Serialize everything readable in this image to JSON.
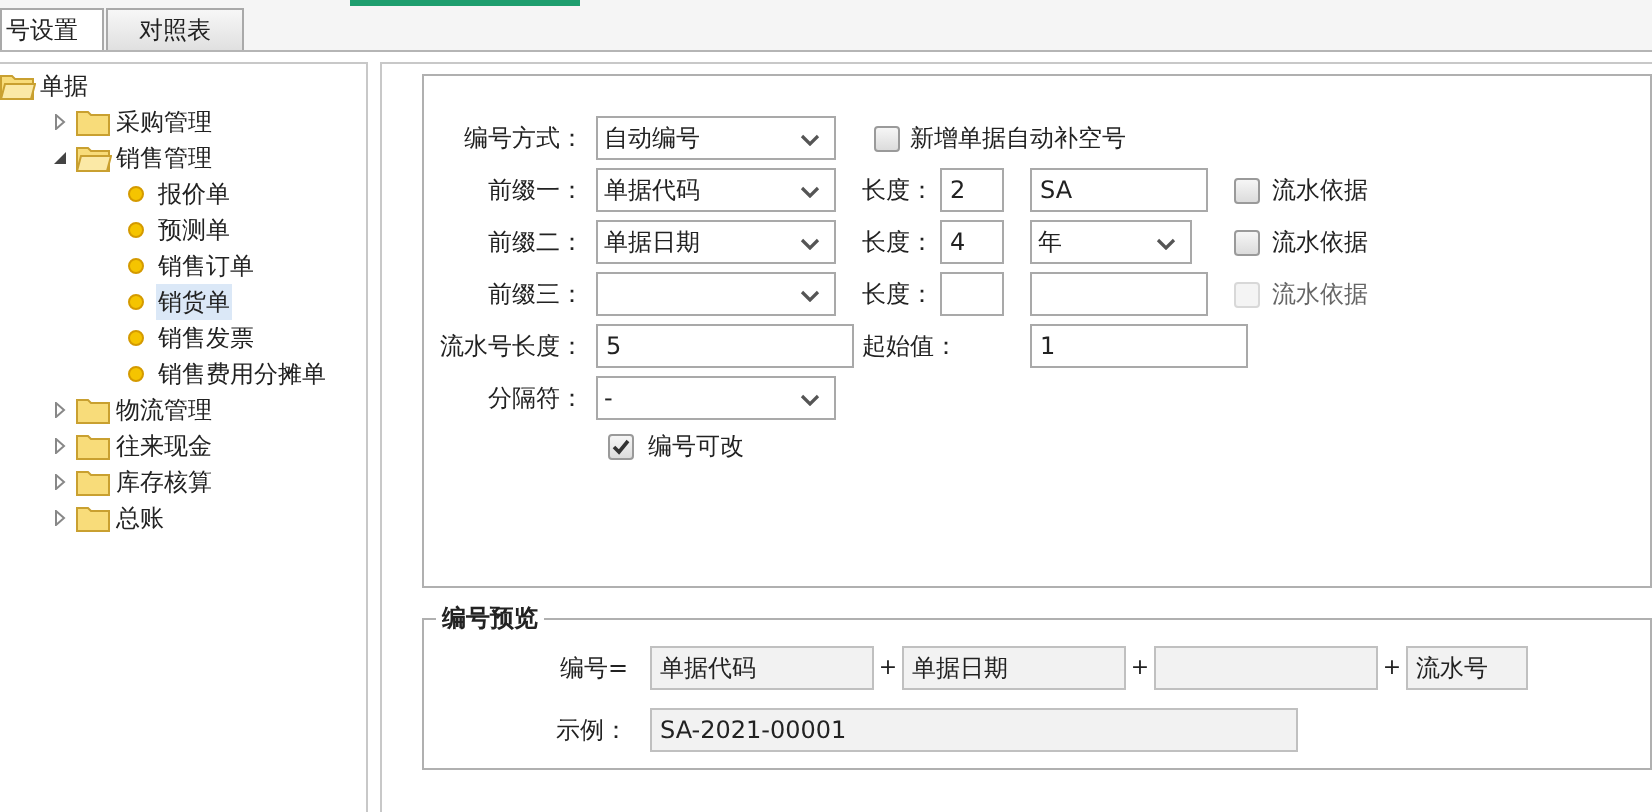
{
  "tabs": [
    {
      "label": "号设置",
      "selected": true
    },
    {
      "label": "对照表",
      "selected": false
    }
  ],
  "tree": [
    {
      "label": "单据",
      "kind": "folder",
      "expanded": true,
      "children": [
        {
          "label": "采购管理",
          "kind": "folder",
          "expanded": false
        },
        {
          "label": "销售管理",
          "kind": "folder",
          "expanded": true,
          "children": [
            {
              "label": "报价单",
              "kind": "doc",
              "selected": false
            },
            {
              "label": "预测单",
              "kind": "doc",
              "selected": false
            },
            {
              "label": "销售订单",
              "kind": "doc",
              "selected": false
            },
            {
              "label": "销货单",
              "kind": "doc",
              "selected": true
            },
            {
              "label": "销售发票",
              "kind": "doc",
              "selected": false
            },
            {
              "label": "销售费用分摊单",
              "kind": "doc",
              "selected": false
            }
          ]
        },
        {
          "label": "物流管理",
          "kind": "folder",
          "expanded": false
        },
        {
          "label": "往来现金",
          "kind": "folder",
          "expanded": false
        },
        {
          "label": "库存核算",
          "kind": "folder",
          "expanded": false
        },
        {
          "label": "总账",
          "kind": "folder",
          "expanded": false
        }
      ]
    }
  ],
  "form": {
    "method": {
      "label": "编号方式：",
      "value": "自动编号"
    },
    "auto_fill": {
      "label": "新增单据自动补空号",
      "checked": false
    },
    "prefixes": [
      {
        "label": "前缀一：",
        "value": "单据代码",
        "length_label": "长度：",
        "length": "2",
        "extra": {
          "kind": "input",
          "value": "SA"
        },
        "basis": {
          "label": "流水依据",
          "checked": false,
          "disabled": false
        }
      },
      {
        "label": "前缀二：",
        "value": "单据日期",
        "length_label": "长度：",
        "length": "4",
        "extra": {
          "kind": "select",
          "value": "年"
        },
        "basis": {
          "label": "流水依据",
          "checked": false,
          "disabled": false
        }
      },
      {
        "label": "前缀三：",
        "length_label": "长度：",
        "extra": {
          "kind": "input"
        },
        "basis": {
          "label": "流水依据",
          "checked": false,
          "disabled": true
        }
      }
    ],
    "serial_length": {
      "label": "流水号长度：",
      "value": "5"
    },
    "start": {
      "label": "起始值：",
      "value": "1"
    },
    "separator": {
      "label": "分隔符：",
      "value": "-"
    },
    "editable": {
      "label": "编号可改",
      "checked": true
    }
  },
  "preview": {
    "title": "编号预览",
    "formula_label": "编号=",
    "parts": [
      {
        "value": "单据代码"
      },
      {
        "plus": "+",
        "value": "单据日期"
      },
      {
        "plus": "+"
      },
      {
        "plus": "+",
        "value": "流水号"
      }
    ],
    "example_label": "示例：",
    "example": "SA-2021-00001"
  }
}
